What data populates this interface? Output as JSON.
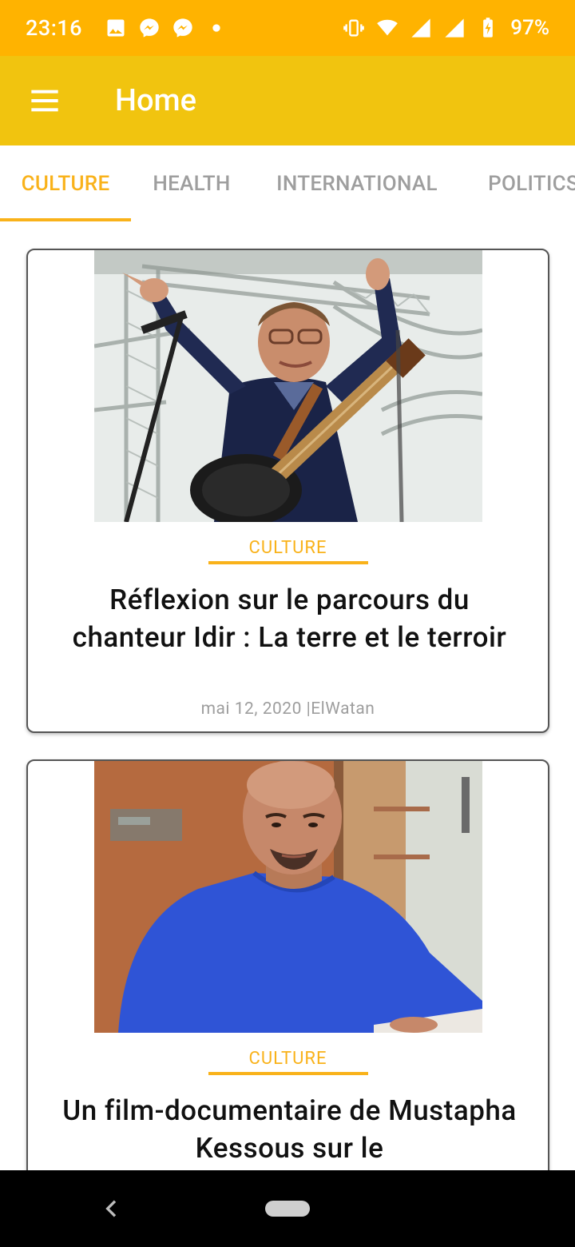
{
  "status_bar": {
    "time": "23:16",
    "battery_percent": "97%",
    "icons_left": [
      "image-icon",
      "messenger-icon",
      "messenger-icon",
      "dot-icon"
    ],
    "icons_right": [
      "vibrate-icon",
      "wifi-icon",
      "signal-icon",
      "signal-icon",
      "battery-charging-icon"
    ],
    "bg_color": "#FFB300"
  },
  "app_bar": {
    "title": "Home",
    "bg_color": "#F1C40F",
    "menu_icon": "hamburger-menu-icon"
  },
  "tabs": [
    {
      "label": "CULTURE",
      "active": true
    },
    {
      "label": "HEALTH",
      "active": false
    },
    {
      "label": "INTERNATIONAL",
      "active": false
    },
    {
      "label": "POLITICS",
      "active": false
    }
  ],
  "accent_color": "#F9B21A",
  "articles": [
    {
      "category": "CULTURE",
      "title": "Réflexion sur le parcours du chanteur Idir : La terre et le terroir",
      "meta": "mai 12, 2020 |ElWatan",
      "image": "singer-with-guitar-photo"
    },
    {
      "category": "CULTURE",
      "title": "Un film-documentaire de Mustapha Kessous sur le",
      "meta": "",
      "image": "man-in-blue-sweater-photo"
    }
  ],
  "nav_bar": {
    "back_icon": "back-chevron-icon",
    "home_icon": "home-pill-icon"
  }
}
